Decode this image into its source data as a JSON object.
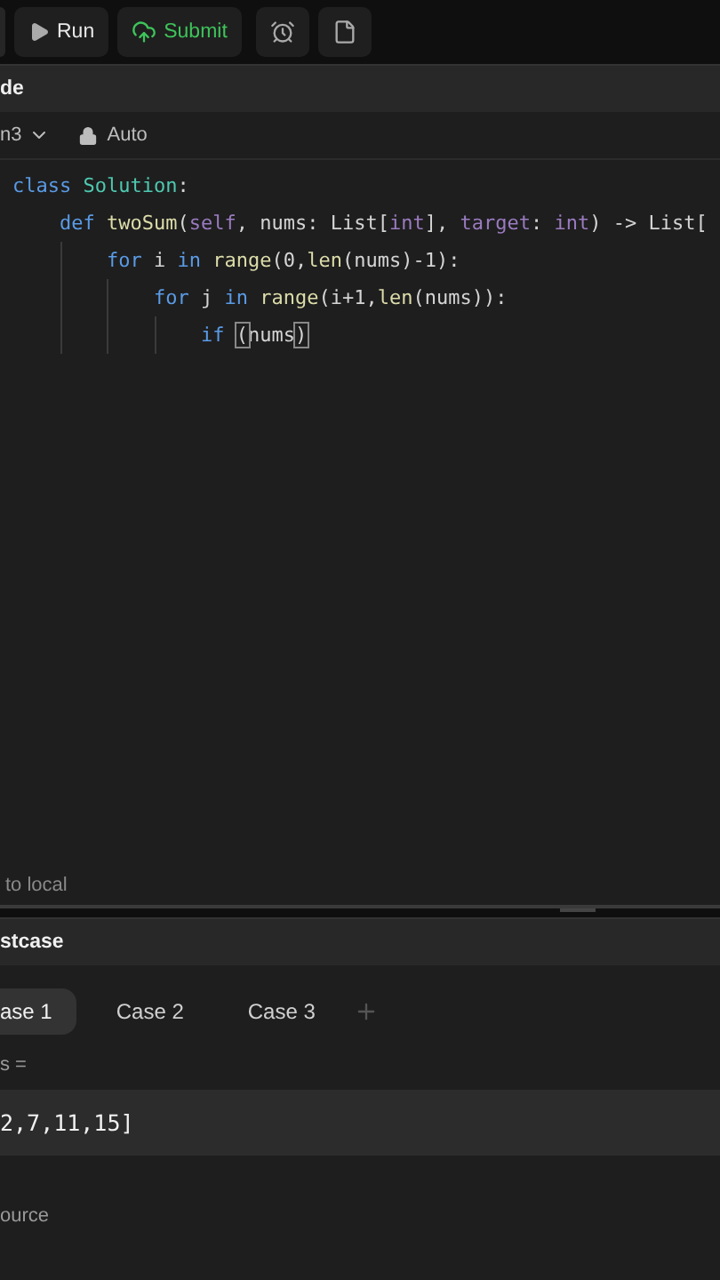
{
  "toolbar": {
    "buttons": [
      {
        "kind": "run",
        "label": "Run"
      },
      {
        "kind": "submit",
        "label": "Submit"
      },
      {
        "kind": "alarm"
      },
      {
        "kind": "note"
      }
    ]
  },
  "editor": {
    "title": "de",
    "language": "n3",
    "mode": "Auto",
    "lines": [
      {
        "tokens": [
          {
            "t": "class ",
            "kind": "kw"
          },
          {
            "t": "Solution",
            "kind": "type"
          },
          {
            "t": ":",
            "kind": "plain"
          }
        ],
        "children": [
          {
            "tokens": [
              {
                "t": "def ",
                "kind": "kw"
              },
              {
                "t": "twoSum",
                "kind": "fn"
              },
              {
                "t": "(",
                "kind": "plain"
              },
              {
                "t": "self",
                "kind": "param"
              },
              {
                "t": ", nums: List[",
                "kind": "plain"
              },
              {
                "t": "int",
                "kind": "param"
              },
              {
                "t": "], ",
                "kind": "plain"
              },
              {
                "t": "target",
                "kind": "param"
              },
              {
                "t": ": ",
                "kind": "plain"
              },
              {
                "t": "int",
                "kind": "param"
              },
              {
                "t": ") -> List[",
                "kind": "plain"
              }
            ],
            "children": [
              {
                "tokens": [
                  {
                    "t": "for ",
                    "kind": "kw"
                  },
                  {
                    "t": "i ",
                    "kind": "plain"
                  },
                  {
                    "t": "in ",
                    "kind": "kw"
                  },
                  {
                    "t": "range",
                    "kind": "fn"
                  },
                  {
                    "t": "(0,",
                    "kind": "plain"
                  },
                  {
                    "t": "len",
                    "kind": "fn"
                  },
                  {
                    "t": "(nums)-1):",
                    "kind": "plain"
                  }
                ],
                "children": [
                  {
                    "tokens": [
                      {
                        "t": "for ",
                        "kind": "kw"
                      },
                      {
                        "t": "j ",
                        "kind": "plain"
                      },
                      {
                        "t": "in ",
                        "kind": "kw"
                      },
                      {
                        "t": "range",
                        "kind": "fn"
                      },
                      {
                        "t": "(i+1,",
                        "kind": "plain"
                      },
                      {
                        "t": "len",
                        "kind": "fn"
                      },
                      {
                        "t": "(nums)):",
                        "kind": "plain"
                      }
                    ],
                    "children": [
                      {
                        "tokens": [
                          {
                            "t": "if ",
                            "kind": "kw"
                          },
                          {
                            "t": "(",
                            "kind": "match"
                          },
                          {
                            "t": "nums",
                            "kind": "plain"
                          },
                          {
                            "t": ")",
                            "kind": "match"
                          }
                        ]
                      }
                    ]
                  }
                ]
              }
            ]
          }
        ]
      }
    ],
    "footer": "to local"
  },
  "testcase": {
    "title": "stcase",
    "tabs": [
      {
        "label": "ase 1",
        "selected": true
      },
      {
        "label": "Case 2",
        "selected": false
      },
      {
        "label": "Case 3",
        "selected": false
      }
    ],
    "input_label": "s =",
    "input_value": "2,7,11,15]",
    "source": "ource"
  }
}
